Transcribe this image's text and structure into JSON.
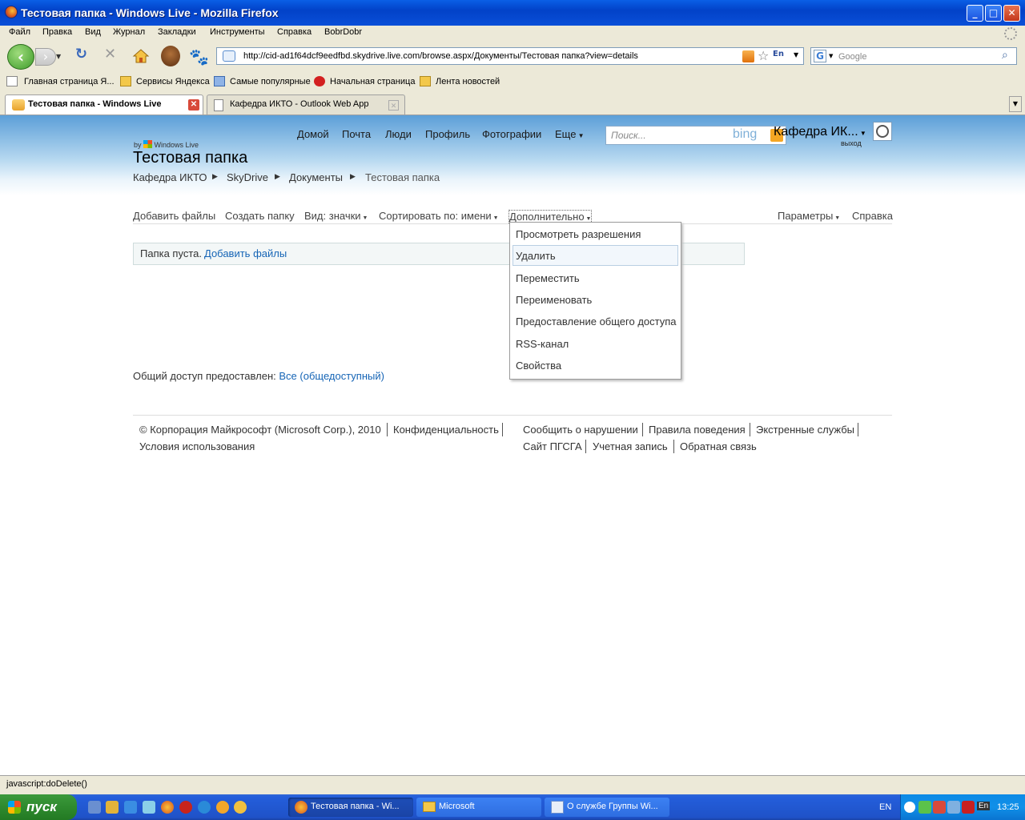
{
  "window": {
    "title": "Тестовая папка - Windows Live - Mozilla Firefox"
  },
  "menubar": {
    "items": [
      "Файл",
      "Правка",
      "Вид",
      "Журнал",
      "Закладки",
      "Инструменты",
      "Справка",
      "BobrDobr"
    ]
  },
  "navbar": {
    "url": "http://cid-ad1f64dcf9eedfbd.skydrive.live.com/browse.aspx/Документы/Тестовая папка?view=details",
    "search_placeholder": "Google",
    "lang": "En"
  },
  "bookmarks": {
    "items": [
      "Главная страница Я...",
      "Сервисы Яндекса",
      "Самые популярные",
      "Начальная страница",
      "Лента новостей"
    ]
  },
  "tabs": [
    {
      "label": "Тестовая папка - Windows Live",
      "active": true
    },
    {
      "label": "Кафедра ИКТО - Outlook Web App",
      "active": false
    }
  ],
  "live": {
    "brand_by": "by",
    "brand_name": "Windows Live",
    "page_title": "Тестовая папка",
    "nav": [
      "Домой",
      "Почта",
      "Люди",
      "Профиль",
      "Фотографии",
      "Еще"
    ],
    "search_placeholder": "Поиск...",
    "search_brand": "bing",
    "user_name": "Кафедра ИК...",
    "signout": "выход",
    "breadcrumb": [
      "Кафедра ИКТО",
      "SkyDrive",
      "Документы",
      "Тестовая папка"
    ],
    "commands": {
      "add_files": "Добавить файлы",
      "create_folder": "Создать папку",
      "view": "Вид: значки",
      "sort": "Сортировать по: имени",
      "more": "Дополнительно",
      "params": "Параметры",
      "help": "Справка"
    },
    "empty_text": "Папка пуста.",
    "empty_link": "Добавить файлы",
    "dropdown": [
      "Просмотреть разрешения",
      "Удалить",
      "Переместить",
      "Переименовать",
      "Предоставление общего доступа",
      "RSS-канал",
      "Свойства"
    ],
    "dropdown_highlight_index": 1,
    "shared_label": "Общий доступ предоставлен:",
    "shared_link": "Все (общедоступный)",
    "footer": {
      "copyright": "© Корпорация Майкрософт (Microsoft Corp.), 2010",
      "privacy": "Конфиденциальность",
      "terms": "Условия использования",
      "report": "Сообщить о нарушении",
      "conduct": "Правила поведения",
      "emergency": "Экстренные службы",
      "site": "Сайт ПГСГА",
      "account": "Учетная запись",
      "feedback": "Обратная связь"
    }
  },
  "status": {
    "text": "javascript:doDelete()"
  },
  "taskbar": {
    "start": "пуск",
    "tasks": [
      "Тестовая папка - Wi...",
      "Microsoft",
      "О службе Группы Wi..."
    ],
    "tray_lang": "EN",
    "tray_lang2": "En",
    "clock": "13:25"
  },
  "colors": {
    "link": "#1665b6",
    "xp_blue": "#245edb",
    "start_green": "#2e8a2e"
  }
}
